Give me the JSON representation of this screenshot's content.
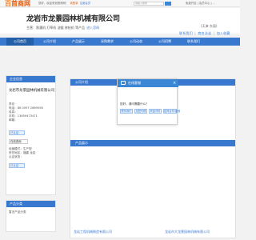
{
  "topbar": {
    "logo_mark": "百",
    "logo_text": "首商网",
    "links": "您好，欢迎来到首商网！",
    "register": "请登录",
    "home": "注册会员",
    "search_placeholder": "请输入搜索",
    "right_links": "免费开店  |  会员中心  |  ..."
  },
  "header": {
    "company": "龙岩市龙景园林机械有限公司",
    "sub": "主营：割灌机 打草机 油锯 修枝机 等产品",
    "sub_link": "进入官网",
    "tagline": "(天津 东丽)",
    "links": [
      "联系我们",
      "商务洽谈",
      "加入收藏"
    ]
  },
  "nav": {
    "items": [
      "公司首页",
      "公司介绍",
      "产品展示",
      "采购需求",
      "公司动态",
      "公司招聘",
      "联系我们"
    ]
  },
  "info_panel": {
    "title": "企业信息",
    "company": "龙岩市龙景园林机械有限公司",
    "contact": "李总",
    "phone": "电话：86 0597 2669556",
    "fax": "传真：",
    "mobile": "手机：13659473471",
    "email": "邮箱：",
    "badge": "已认证",
    "mobile_label": "在线咨询",
    "meta1": "经营模式：生产型",
    "meta2": "所在地区：福建 龙岩",
    "meta3": "认证状态：",
    "badge2": "已认证"
  },
  "cat_panel": {
    "title": "产品分类",
    "item": "暂无产品分类"
  },
  "main": {
    "heading1": "公司介绍",
    "heading2": "产品展示",
    "prod1": "龙岩工程机械制造有限公司",
    "prod2": "龙岩市大龙景园林机械有限公司"
  },
  "popup": {
    "title": "在线客服",
    "prompt": "您好，请问需要什么？",
    "options": [
      "联系我们",
      "加盟代理",
      "商品详情",
      "招商合作/其他"
    ]
  },
  "colors": {
    "brand_orange": "#e85b0c",
    "nav_blue": "#3878cf",
    "link_blue": "#3b7bd1"
  }
}
